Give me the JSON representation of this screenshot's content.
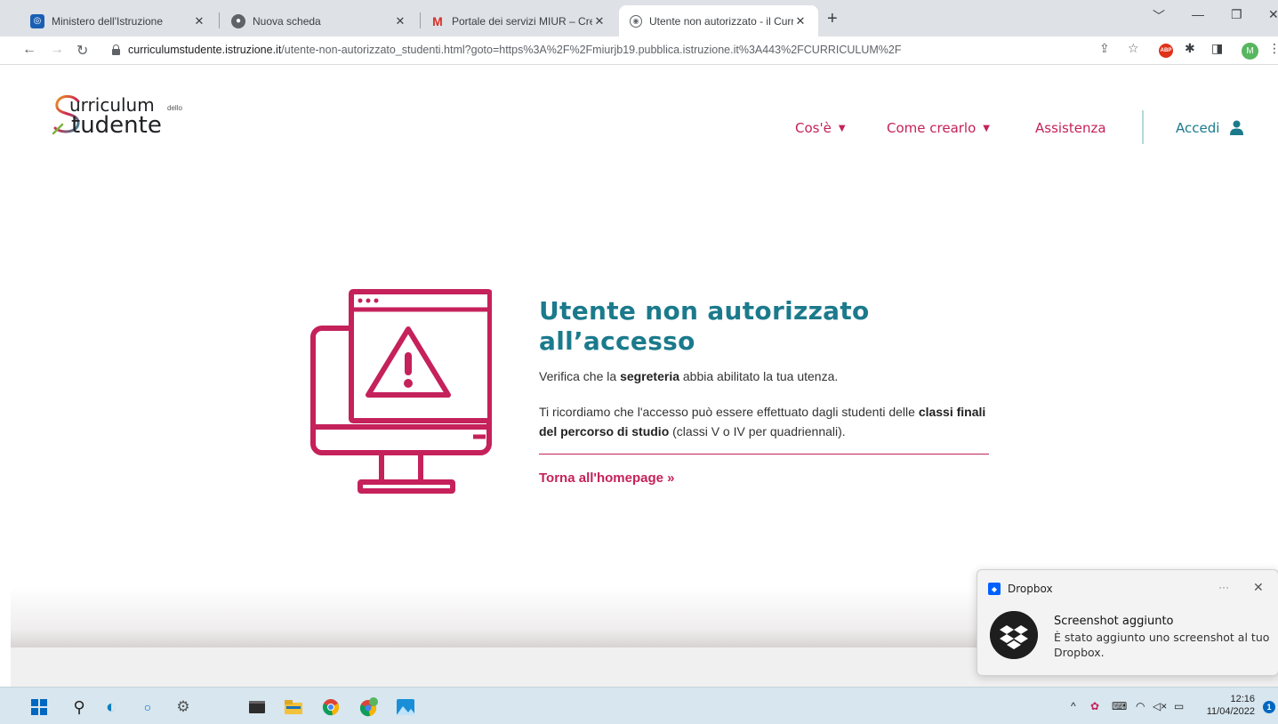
{
  "browser": {
    "tabs": [
      {
        "title": "Ministero dell'Istruzione",
        "active": false
      },
      {
        "title": "Nuova scheda",
        "active": false
      },
      {
        "title": "Portale dei servizi MIUR – Creazio",
        "active": false
      },
      {
        "title": "Utente non autorizzato - il Curric",
        "active": true
      }
    ],
    "url_host": "curriculumstudente.istruzione.it",
    "url_path": "/utente-non-autorizzato_studenti.html?goto=https%3A%2F%2Fmiurjb19.pubblica.istruzione.it%3A443%2FCURRICULUM%2F",
    "profile_initial": "M",
    "abp_label": "ABP"
  },
  "site": {
    "logo_line1": "urriculum",
    "logo_small": "dello",
    "logo_line2": "tudente",
    "nav": {
      "cose": "Cos'è",
      "come": "Come crearlo",
      "assistenza": "Assistenza",
      "accedi": "Accedi"
    }
  },
  "main": {
    "title": "Utente non autorizzato all’accesso",
    "p1_pre": "Verifica che la ",
    "p1_bold": "segreteria",
    "p1_post": " abbia abilitato la tua utenza.",
    "p2_pre": "Ti ricordiamo che l'accesso può essere effettuato dagli studenti delle ",
    "p2_bold": "classi finali del percorso di studio",
    "p2_post": " (classi V o IV per quadriennali).",
    "home_link": "Torna all'homepage",
    "home_arrow": "»"
  },
  "toast": {
    "app": "Dropbox",
    "title": "Screenshot aggiunto",
    "body": "È stato aggiunto uno screenshot al tuo Dropbox."
  },
  "taskbar": {
    "time": "12:16",
    "date": "11/04/2022",
    "notifications": "1"
  },
  "colors": {
    "accent_pink": "#c5215a",
    "accent_teal": "#1b7a8c",
    "dropbox_blue": "#0061fe"
  }
}
